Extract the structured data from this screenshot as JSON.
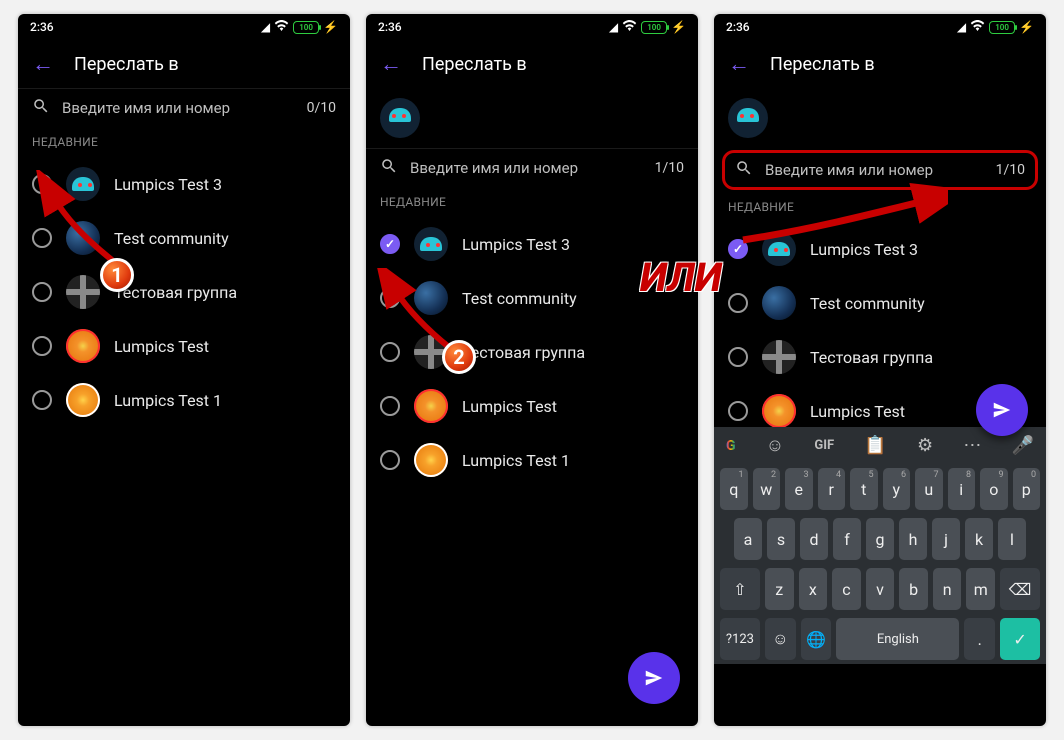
{
  "status": {
    "time": "2:36",
    "battery_pct": "100"
  },
  "header": {
    "title": "Переслать в"
  },
  "search": {
    "placeholder": "Введите имя или номер"
  },
  "counter_0": "0/10",
  "counter_1": "1/10",
  "section_recent": "НЕДАВНИЕ",
  "contacts": [
    {
      "name": "Lumpics Test 3",
      "avatar": "cyan-droid"
    },
    {
      "name": "Test community",
      "avatar": "earth"
    },
    {
      "name": "Тестовая группа",
      "avatar": "cross"
    },
    {
      "name": "Lumpics Test",
      "avatar": "orange"
    },
    {
      "name": "Lumpics Test 1",
      "avatar": "orange2"
    }
  ],
  "keyboard": {
    "lang": "English",
    "sym_key": "?123"
  },
  "overlay": {
    "or_label": "ИЛИ",
    "badge1": "1",
    "badge2": "2"
  }
}
